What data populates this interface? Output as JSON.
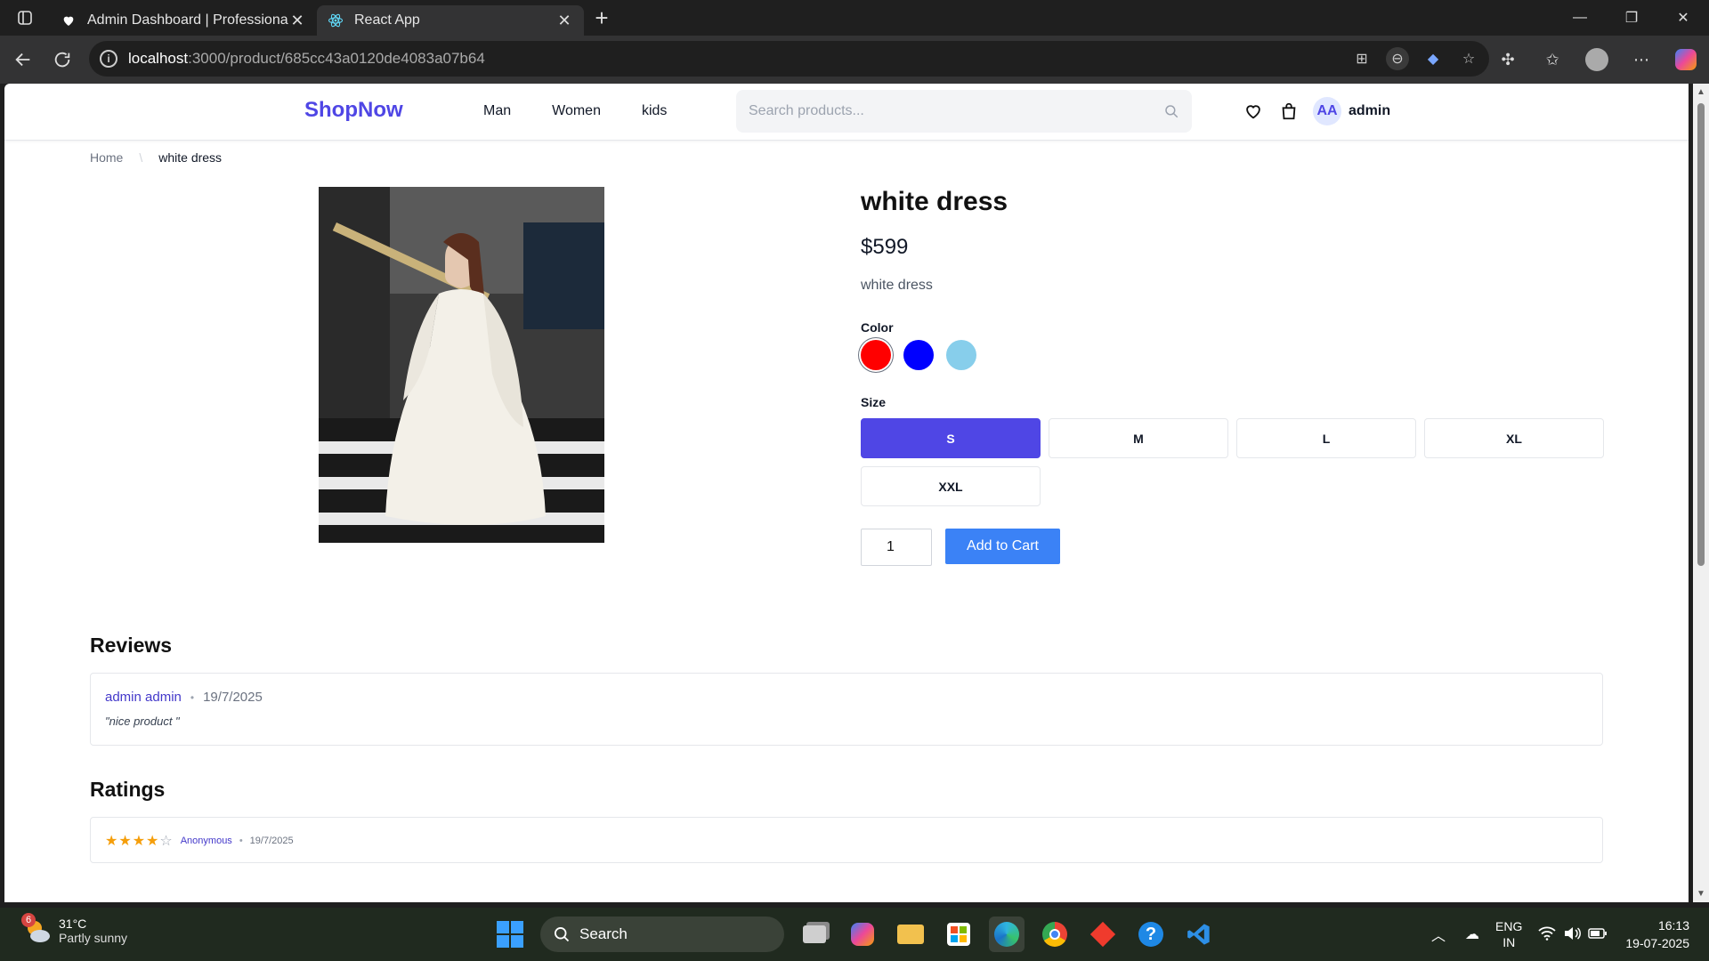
{
  "browser": {
    "tabs": [
      {
        "title": "Admin Dashboard | Professional M",
        "active": false
      },
      {
        "title": "React App",
        "active": true
      }
    ],
    "url_host": "localhost",
    "url_path": ":3000/product/685cc43a0120de4083a07b64"
  },
  "header": {
    "logo": "ShopNow",
    "nav": [
      "Man",
      "Women",
      "kids"
    ],
    "search_placeholder": "Search products...",
    "avatar_initials": "AA",
    "username": "admin"
  },
  "breadcrumb": {
    "home": "Home",
    "current": "white dress"
  },
  "product": {
    "title": "white dress",
    "price": "$599",
    "description": "white dress",
    "color_label": "Color",
    "colors": [
      "#ff0000",
      "#0000ff",
      "#87ceeb"
    ],
    "size_label": "Size",
    "sizes": [
      "S",
      "M",
      "L",
      "XL",
      "XXL"
    ],
    "selected_size": "S",
    "quantity": "1",
    "add_to_cart": "Add to Cart"
  },
  "reviews": {
    "heading": "Reviews",
    "items": [
      {
        "author": "admin admin",
        "date": "19/7/2025",
        "text": "\"nice product \""
      }
    ]
  },
  "ratings": {
    "heading": "Ratings",
    "items": [
      {
        "stars": 4,
        "max": 5,
        "author": "Anonymous",
        "date": "19/7/2025"
      }
    ]
  },
  "taskbar": {
    "weather_badge": "6",
    "temperature": "31°C",
    "weather": "Partly sunny",
    "search": "Search",
    "lang_1": "ENG",
    "lang_2": "IN",
    "time": "16:13",
    "date": "19-07-2025"
  },
  "colors": {
    "brand": "#4f46e5",
    "button": "#3b82f6"
  }
}
